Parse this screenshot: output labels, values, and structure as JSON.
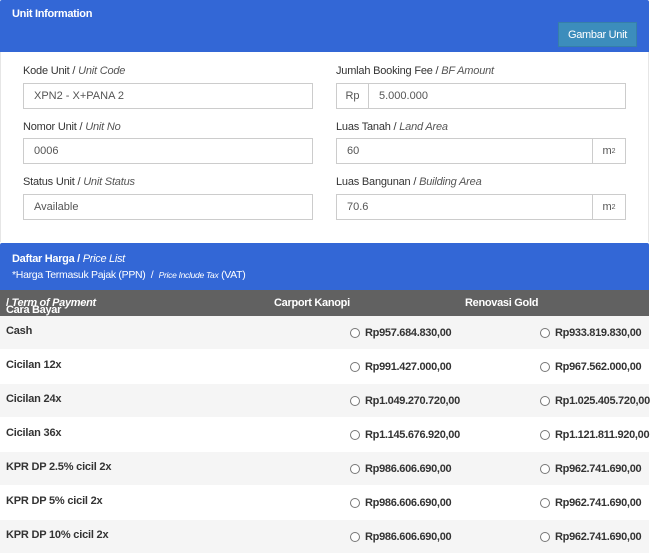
{
  "unit_info": {
    "title": "Unit Information",
    "gambar_button": "Gambar Unit",
    "kode_unit": {
      "label": "Kode Unit",
      "label_en": "Unit Code",
      "value": "XPN2 - X+PANA 2"
    },
    "nomor_unit": {
      "label": "Nomor Unit",
      "label_en": "Unit No",
      "value": "0006"
    },
    "status_unit": {
      "label": "Status Unit",
      "label_en": "Unit Status",
      "value": "Available"
    },
    "booking_fee": {
      "label": "Jumlah Booking Fee",
      "label_en": "BF Amount",
      "prefix": "Rp",
      "value": "5.000.000"
    },
    "luas_tanah": {
      "label": "Luas Tanah",
      "label_en": "Land Area",
      "value": "60",
      "unit": "m",
      "unit_sup": "2"
    },
    "luas_bangunan": {
      "label": "Luas Bangunan",
      "label_en": "Building Area",
      "value": "70.6",
      "unit": "m",
      "unit_sup": "2"
    }
  },
  "price_list": {
    "title": "Daftar Harga",
    "title_en": "Price List",
    "tax_note": "*Harga Termasuk Pajak (PPN)",
    "tax_sep": "/",
    "tax_note_en": "Price Include Tax",
    "tax_note_vat": "(VAT)",
    "columns": {
      "payment": "Cara Bayar",
      "payment_en": "Term of Payment",
      "option1": "Carport Kanopi",
      "option2": "Renovasi Gold"
    },
    "rows": [
      {
        "name": "Cash",
        "price1": "Rp957.684.830,00",
        "price2": "Rp933.819.830,00"
      },
      {
        "name": "Cicilan 12x",
        "price1": "Rp991.427.000,00",
        "price2": "Rp967.562.000,00"
      },
      {
        "name": "Cicilan 24x",
        "price1": "Rp1.049.270.720,00",
        "price2": "Rp1.025.405.720,00"
      },
      {
        "name": "Cicilan 36x",
        "price1": "Rp1.145.676.920,00",
        "price2": "Rp1.121.811.920,00"
      },
      {
        "name": "KPR DP 2.5% cicil 2x",
        "price1": "Rp986.606.690,00",
        "price2": "Rp962.741.690,00"
      },
      {
        "name": "KPR DP 5% cicil 2x",
        "price1": "Rp986.606.690,00",
        "price2": "Rp962.741.690,00"
      },
      {
        "name": "KPR DP 10% cicil 2x",
        "price1": "Rp986.606.690,00",
        "price2": "Rp962.741.690,00"
      }
    ]
  },
  "colors": {
    "header_blue": "#3367d6",
    "table_head": "#616161",
    "button": "#3c8dbc"
  }
}
